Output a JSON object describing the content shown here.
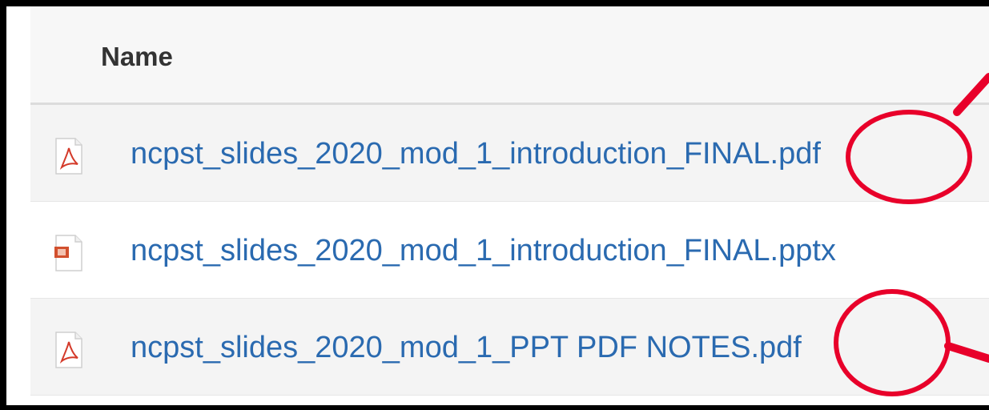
{
  "table": {
    "header": {
      "name_label": "Name"
    },
    "files": [
      {
        "name": "ncpst_slides_2020_mod_1_introduction_FINAL.pdf",
        "type": "pdf",
        "icon": "pdf-file-icon"
      },
      {
        "name": "ncpst_slides_2020_mod_1_introduction_FINAL.pptx",
        "type": "pptx",
        "icon": "pptx-file-icon"
      },
      {
        "name": "ncpst_slides_2020_mod_1_PPT PDF NOTES.pdf",
        "type": "pdf",
        "icon": "pdf-file-icon"
      }
    ]
  },
  "annotation": {
    "color": "#e8002a",
    "highlights": [
      "extension-circle",
      "extension-circle"
    ]
  },
  "colors": {
    "link": "#2a6ab0",
    "header_bg": "#f7f7f7",
    "row_alt_bg": "#f4f4f4",
    "border": "#000000"
  }
}
